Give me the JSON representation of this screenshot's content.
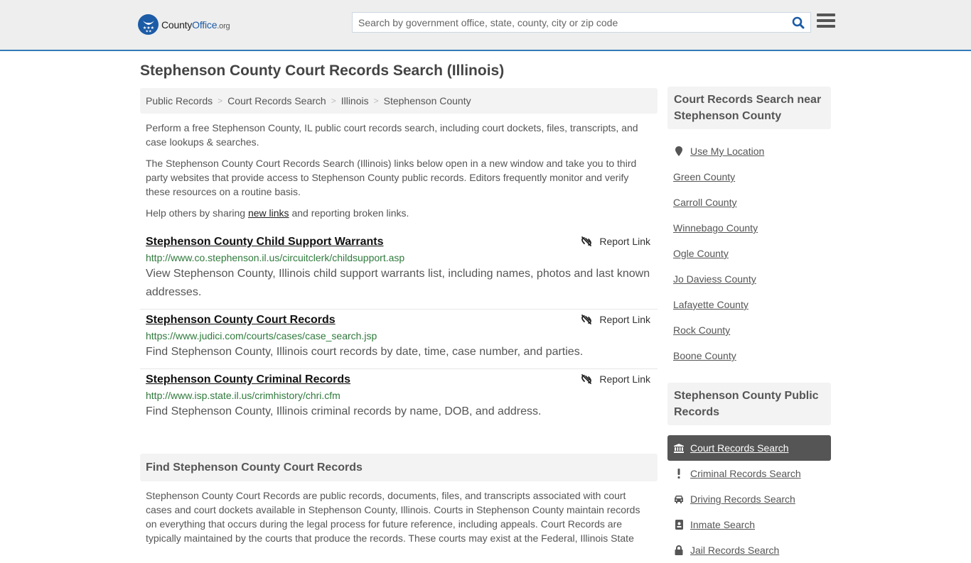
{
  "header": {
    "logo": {
      "name_part1": "County",
      "name_part2": "Office",
      "tld": ".org"
    },
    "search": {
      "placeholder": "Search by government office, state, county, city or zip code",
      "value": ""
    },
    "icons": {
      "search": "search-icon",
      "menu": "hamburger-menu-icon",
      "logo": "eagle-stars-logo-icon"
    }
  },
  "page": {
    "title": "Stephenson County Court Records Search (Illinois)"
  },
  "breadcrumb": [
    {
      "label": "Public Records"
    },
    {
      "label": "Court Records Search"
    },
    {
      "label": "Illinois"
    },
    {
      "label": "Stephenson County"
    }
  ],
  "intro": {
    "p1": "Perform a free Stephenson County, IL public court records search, including court dockets, files, transcripts, and case lookups & searches.",
    "p2": "The Stephenson County Court Records Search (Illinois) links below open in a new window and take you to third party websites that provide access to Stephenson County public records. Editors frequently monitor and verify these resources on a routine basis.",
    "p3_before": "Help others by sharing ",
    "p3_link": "new links",
    "p3_after": " and reporting broken links."
  },
  "links": [
    {
      "title": "Stephenson County Child Support Warrants",
      "url": "http://www.co.stephenson.il.us/circuitclerk/childsupport.asp",
      "description": "View Stephenson County, Illinois child support warrants list, including names, photos and last known addresses.",
      "report_label": "Report Link"
    },
    {
      "title": "Stephenson County Court Records",
      "url": "https://www.judici.com/courts/cases/case_search.jsp",
      "description": "Find Stephenson County, Illinois court records by date, time, case number, and parties.",
      "report_label": "Report Link"
    },
    {
      "title": "Stephenson County Criminal Records",
      "url": "http://www.isp.state.il.us/crimhistory/chri.cfm",
      "description": "Find Stephenson County, Illinois criminal records by name, DOB, and address.",
      "report_label": "Report Link"
    }
  ],
  "find_section": {
    "heading": "Find Stephenson County Court Records",
    "body": "Stephenson County Court Records are public records, documents, files, and transcripts associated with court cases and court dockets available in Stephenson County, Illinois. Courts in Stephenson County maintain records on everything that occurs during the legal process for future reference, including appeals. Court Records are typically maintained by the courts that produce the records. These courts may exist at the Federal, Illinois State"
  },
  "sidebar": {
    "nearby": {
      "heading": "Court Records Search near Stephenson County",
      "use_location": "Use My Location",
      "counties": [
        "Green County",
        "Carroll County",
        "Winnebago County",
        "Ogle County",
        "Jo Daviess County",
        "Lafayette County",
        "Rock County",
        "Boone County"
      ]
    },
    "public_records": {
      "heading": "Stephenson County Public Records",
      "items": [
        {
          "label": "Court Records Search",
          "icon": "courthouse-icon",
          "active": true
        },
        {
          "label": "Criminal Records Search",
          "icon": "exclamation-icon",
          "active": false
        },
        {
          "label": "Driving Records Search",
          "icon": "car-icon",
          "active": false
        },
        {
          "label": "Inmate Search",
          "icon": "id-badge-icon",
          "active": false
        },
        {
          "label": "Jail Records Search",
          "icon": "lock-icon",
          "active": false
        }
      ]
    }
  },
  "colors": {
    "accent_blue": "#337ab7",
    "logo_blue": "#1c5ba6",
    "url_green": "#2f7a3c",
    "active_item_bg": "#555555"
  }
}
